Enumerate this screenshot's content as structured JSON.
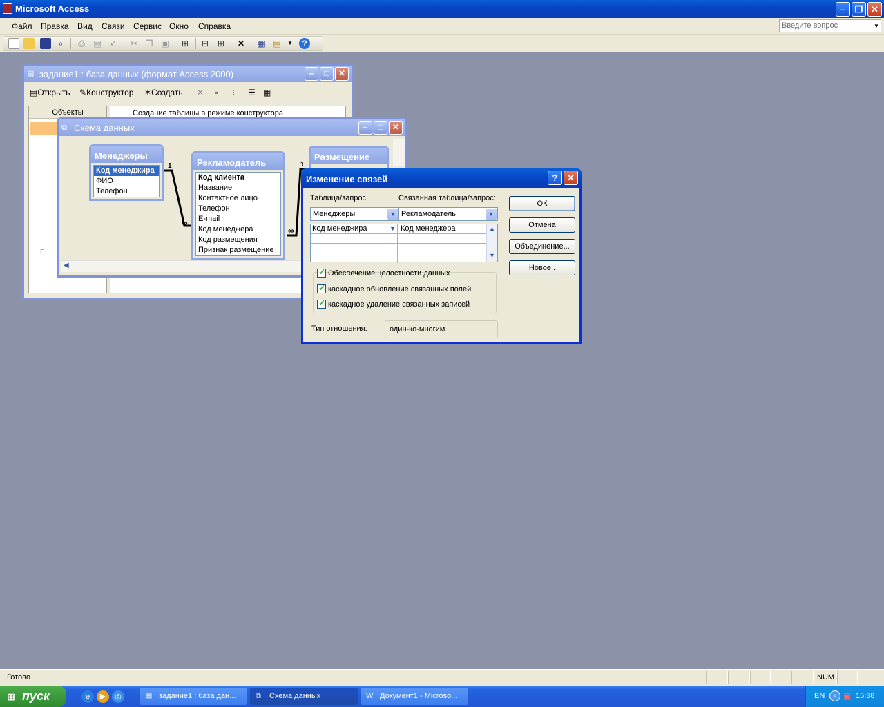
{
  "app": {
    "title": "Microsoft Access",
    "ask_placeholder": "Введите вопрос"
  },
  "menu": [
    "Файл",
    "Правка",
    "Вид",
    "Связи",
    "Сервис",
    "Окно",
    "Справка"
  ],
  "db_window": {
    "title": "задание1 : база данных (формат Access 2000)",
    "toolbar": {
      "open": "Открыть",
      "design": "Конструктор",
      "create": "Создать"
    },
    "objects_header": "Объекты",
    "list_item": "Создание таблицы в режиме конструктора",
    "group_letter": "Г"
  },
  "schema_window": {
    "title": "Схема данных",
    "tables": [
      {
        "name": "Менеджеры",
        "fields": [
          "Код менеджира",
          "ФИО",
          "Телефон"
        ]
      },
      {
        "name": "Рекламодатель",
        "fields": [
          "Код клиента",
          "Название",
          "Контактное лицо",
          "Телефон",
          "E-mail",
          "Код менеджера",
          "Код размещения",
          "Признак размещение"
        ]
      },
      {
        "name": "Размещение",
        "fields": []
      }
    ],
    "rel_one": "1",
    "rel_many": "∞"
  },
  "dialog": {
    "title": "Изменение связей",
    "table_label": "Таблица/запрос:",
    "related_label": "Связанная таблица/запрос:",
    "table_value": "Менеджеры",
    "related_value": "Рекламодатель",
    "grid_row": {
      "left": "Код менеджира",
      "right": "Код менеджера"
    },
    "checks": [
      "Обеспечение целостности данных",
      "каскадное обновление связанных полей",
      "каскадное удаление связанных записей"
    ],
    "relation_type_label": "Тип отношения:",
    "relation_type_value": "один-ко-многим",
    "buttons": {
      "ok": "ОК",
      "cancel": "Отмена",
      "join": "Объединение...",
      "new": "Новое.."
    }
  },
  "status": {
    "text": "Готово",
    "num": "NUM"
  },
  "taskbar": {
    "start": "пуск",
    "tasks": [
      "задание1 : база дан...",
      "Схема данных",
      "Документ1 - Microso..."
    ],
    "lang": "EN",
    "time": "15:38"
  }
}
